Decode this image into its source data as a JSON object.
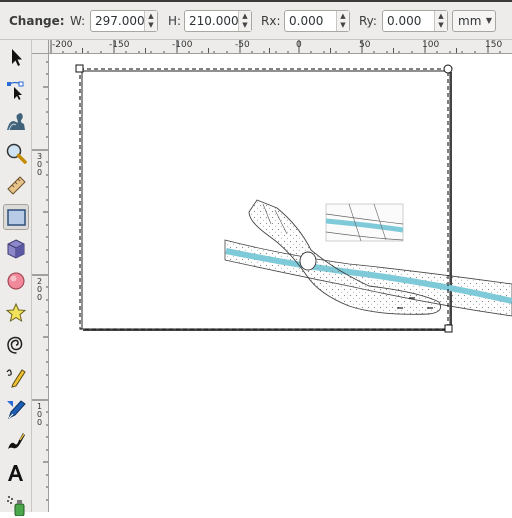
{
  "toolbar": {
    "change_label": "Change:",
    "w_label": "W:",
    "w_value": "297.000",
    "h_label": "H:",
    "h_value": "210.000",
    "rx_label": "Rx:",
    "rx_value": "0.000",
    "ry_label": "Ry:",
    "ry_value": "0.000",
    "unit": "mm"
  },
  "ruler_h": [
    "-200",
    "-150",
    "-100",
    "-50",
    "0",
    "50",
    "100",
    "150"
  ],
  "ruler_v": [
    {
      "digits": [
        "3",
        "0",
        "0"
      ]
    },
    {
      "digits": [
        "2",
        "0",
        "0"
      ]
    },
    {
      "digits": [
        "1",
        "0",
        "0"
      ]
    }
  ],
  "tools": [
    {
      "name": "selector-tool-icon",
      "active": false
    },
    {
      "name": "node-tool-icon",
      "active": false
    },
    {
      "name": "tweak-tool-icon",
      "active": false
    },
    {
      "name": "zoom-tool-icon",
      "active": false
    },
    {
      "name": "measure-tool-icon",
      "active": false
    },
    {
      "name": "rectangle-tool-icon",
      "active": true
    },
    {
      "name": "3d-box-tool-icon",
      "active": false
    },
    {
      "name": "ellipse-tool-icon",
      "active": false
    },
    {
      "name": "star-tool-icon",
      "active": false
    },
    {
      "name": "spiral-tool-icon",
      "active": false
    },
    {
      "name": "pencil-tool-icon",
      "active": false
    },
    {
      "name": "pen-tool-icon",
      "active": false
    },
    {
      "name": "calligraphy-tool-icon",
      "active": false
    },
    {
      "name": "text-tool-icon",
      "active": false
    },
    {
      "name": "spray-tool-icon",
      "active": false
    }
  ],
  "colors": {
    "river": "#7ecad8",
    "selection": "#000000",
    "toolbar_bg": "#edeceb"
  }
}
